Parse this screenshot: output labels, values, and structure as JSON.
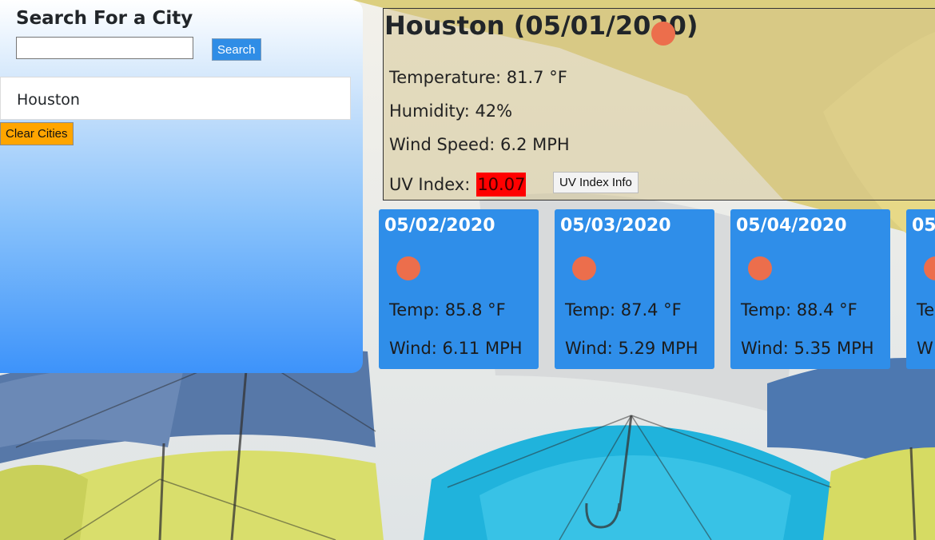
{
  "sidebar": {
    "title": "Search For a City",
    "search_placeholder": "",
    "search_value": "",
    "search_button": "Search",
    "cities": [
      "Houston"
    ],
    "clear_button": "Clear Cities",
    "gradient_colors": [
      "#ffffff",
      "#3d93fa"
    ]
  },
  "current": {
    "title": "Houston (05/01/2020)",
    "icon": "weather-icon",
    "temperature": "Temperature: 81.7 °F",
    "humidity": "Humidity: 42%",
    "wind": "Wind Speed: 6.2 MPH",
    "uv_label": "UV Index:",
    "uv_value": "10.07",
    "uv_color": "#ff0000",
    "uv_info_button": "UV Index Info"
  },
  "forecast": [
    {
      "date": "05/02/2020",
      "temp": "Temp: 85.8 °F",
      "wind": "Wind: 6.11 MPH"
    },
    {
      "date": "05/03/2020",
      "temp": "Temp: 87.4 °F",
      "wind": "Wind: 5.29 MPH"
    },
    {
      "date": "05/04/2020",
      "temp": "Temp: 88.4 °F",
      "wind": "Wind: 5.35 MPH"
    },
    {
      "date": "05/",
      "temp": "Te",
      "wind": "W"
    }
  ],
  "colors": {
    "accent": "#2f8ee9",
    "icon": "#ec6e4c",
    "clear_button": "#ffa500"
  }
}
